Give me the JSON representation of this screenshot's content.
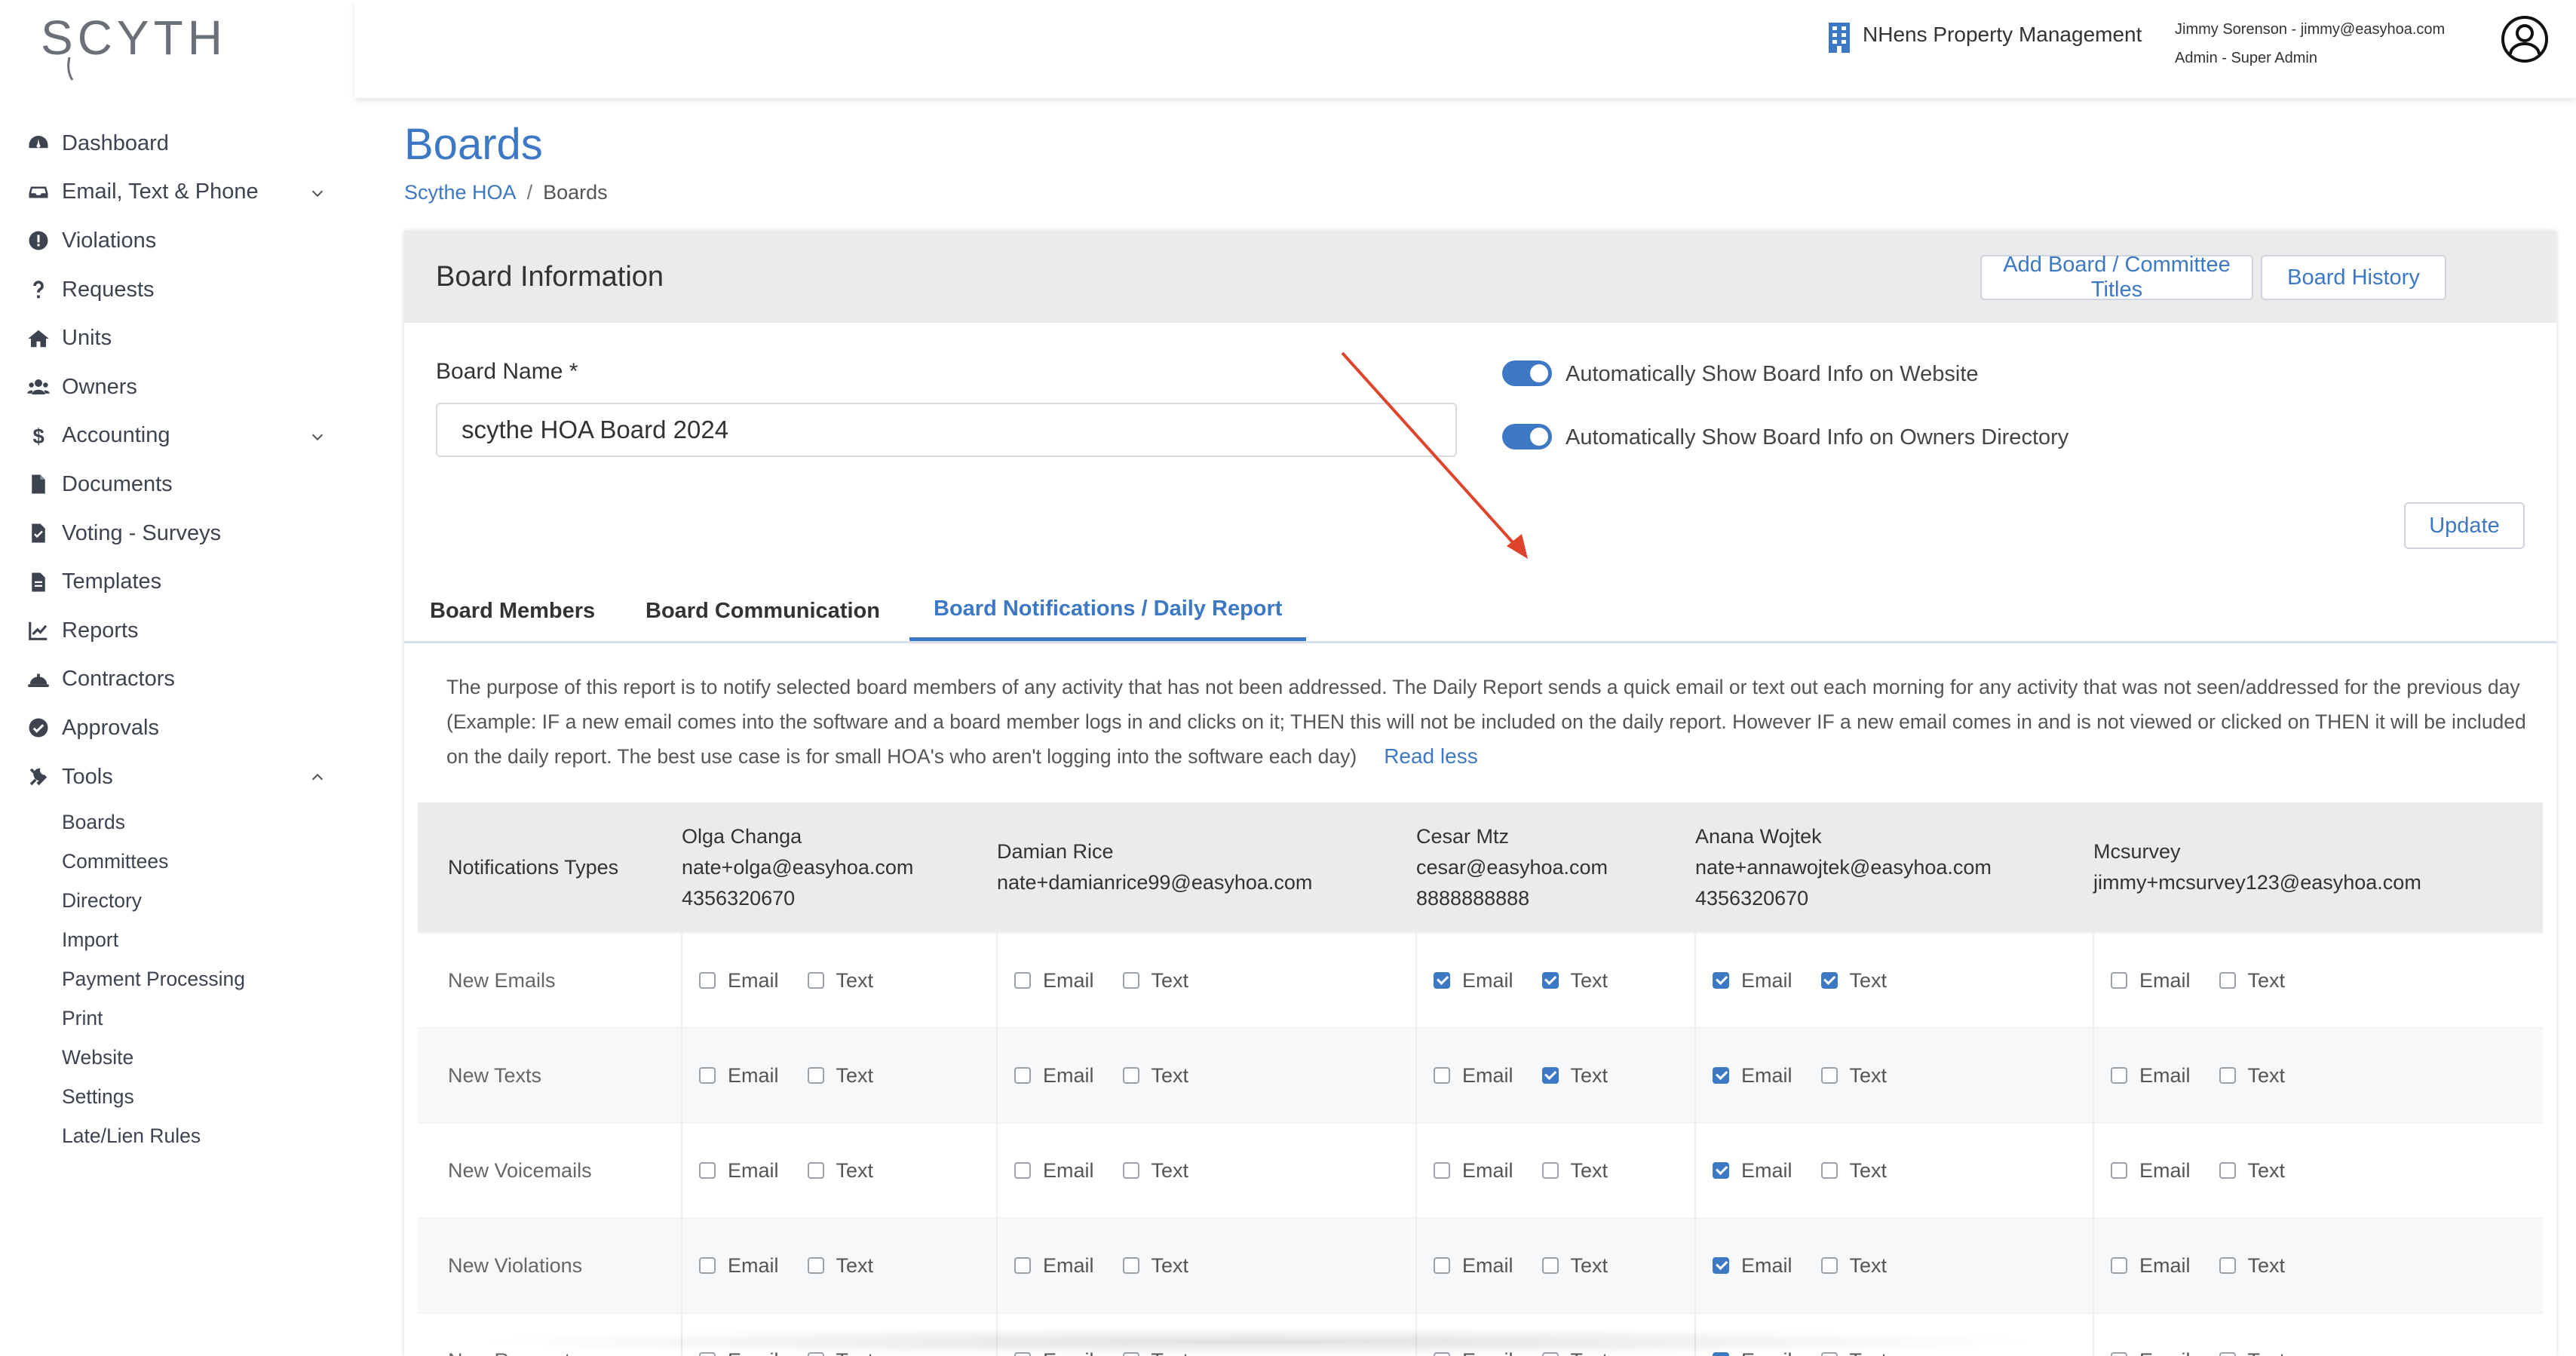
{
  "brand": {
    "logo_text": "SCYTHE",
    "accent": "#3d78c4"
  },
  "sidebar": {
    "items": [
      {
        "label": "Dashboard",
        "icon": "dashboard-icon"
      },
      {
        "label": "Email, Text & Phone",
        "icon": "inbox-icon",
        "expandable": true
      },
      {
        "label": "Violations",
        "icon": "exclamation-icon"
      },
      {
        "label": "Requests",
        "icon": "question-icon"
      },
      {
        "label": "Units",
        "icon": "home-icon"
      },
      {
        "label": "Owners",
        "icon": "users-icon"
      },
      {
        "label": "Accounting",
        "icon": "dollar-icon",
        "expandable": true
      },
      {
        "label": "Documents",
        "icon": "document-icon"
      },
      {
        "label": "Voting - Surveys",
        "icon": "ballot-icon"
      },
      {
        "label": "Templates",
        "icon": "template-icon"
      },
      {
        "label": "Reports",
        "icon": "chart-line-icon"
      },
      {
        "label": "Contractors",
        "icon": "hardhat-icon"
      },
      {
        "label": "Approvals",
        "icon": "check-circle-icon"
      },
      {
        "label": "Tools",
        "icon": "tools-icon",
        "expanded": true
      }
    ],
    "tools_sub": [
      "Boards",
      "Committees",
      "Directory",
      "Import",
      "Payment Processing",
      "Print",
      "Website",
      "Settings",
      "Late/Lien Rules"
    ]
  },
  "header": {
    "company": "NHens Property Management",
    "user_line1": "Jimmy Sorenson - jimmy@easyhoa.com",
    "user_line2": "Admin - Super Admin"
  },
  "page": {
    "title": "Boards",
    "breadcrumb": {
      "link": "Scythe HOA",
      "separator": "/",
      "current": "Boards"
    }
  },
  "card": {
    "title": "Board Information",
    "add_button": "Add Board / Committee Titles",
    "history_button": "Board History",
    "board_name_label": "Board Name *",
    "board_name_value": "scythe HOA Board 2024",
    "toggle_website": "Automatically Show Board Info on Website",
    "toggle_directory": "Automatically Show Board Info on Owners Directory",
    "update_button": "Update"
  },
  "tabs": {
    "members": "Board Members",
    "communication": "Board Communication",
    "notifications": "Board Notifications / Daily Report"
  },
  "report": {
    "description": "The purpose of this report is to notify selected board members of any activity that has not been addressed. The Daily Report sends a quick email or text out each morning for any activity that was not seen/addressed for the previous day (Example: IF a new email comes into the software and a board member logs in and clicks on it; THEN this will not be included on the daily report. However IF a new email comes in and is not viewed or clicked on THEN it will be included on the daily report. The best use case is for small HOA's who aren't logging into the software each day)",
    "read_less": "Read less"
  },
  "table": {
    "type_header": "Notifications Types",
    "email_label": "Email",
    "text_label": "Text",
    "members": [
      {
        "name": "Olga Changa",
        "email": "nate+olga@easyhoa.com",
        "phone": "4356320670"
      },
      {
        "name": "Damian Rice",
        "email": "nate+damianrice99@easyhoa.com",
        "phone": ""
      },
      {
        "name": "Cesar Mtz",
        "email": "cesar@easyhoa.com",
        "phone": "8888888888"
      },
      {
        "name": "Anana Wojtek",
        "email": "nate+annawojtek@easyhoa.com",
        "phone": "4356320670"
      },
      {
        "name": "Mcsurvey",
        "email": "jimmy+mcsurvey123@easyhoa.com",
        "phone": ""
      }
    ],
    "rows": [
      {
        "type": "New Emails",
        "checks": [
          [
            false,
            false
          ],
          [
            false,
            false
          ],
          [
            true,
            true
          ],
          [
            true,
            true
          ],
          [
            false,
            false
          ]
        ]
      },
      {
        "type": "New Texts",
        "checks": [
          [
            false,
            false
          ],
          [
            false,
            false
          ],
          [
            false,
            true
          ],
          [
            true,
            false
          ],
          [
            false,
            false
          ]
        ]
      },
      {
        "type": "New Voicemails",
        "checks": [
          [
            false,
            false
          ],
          [
            false,
            false
          ],
          [
            false,
            false
          ],
          [
            true,
            false
          ],
          [
            false,
            false
          ]
        ]
      },
      {
        "type": "New Violations",
        "checks": [
          [
            false,
            false
          ],
          [
            false,
            false
          ],
          [
            false,
            false
          ],
          [
            true,
            false
          ],
          [
            false,
            false
          ]
        ]
      },
      {
        "type": "New Requests",
        "checks": [
          [
            false,
            false
          ],
          [
            false,
            false
          ],
          [
            false,
            false
          ],
          [
            true,
            false
          ],
          [
            false,
            false
          ]
        ]
      }
    ]
  }
}
